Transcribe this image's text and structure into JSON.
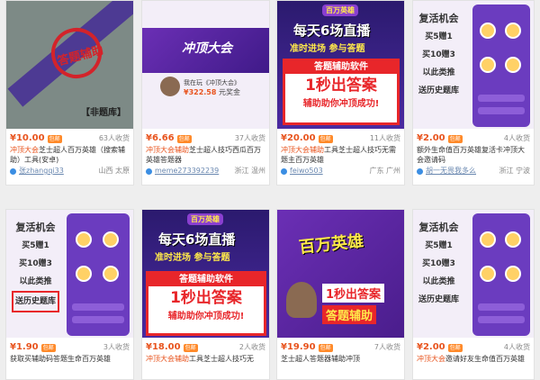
{
  "products": [
    {
      "price": "¥10.00",
      "tag": "包邮",
      "sold": "63人收货",
      "title_hl": "冲顶大会",
      "title": "芝士超人百万英雄（搜索辅助）工具(安卓)",
      "seller": "张zhangqi33",
      "location": "山西 太原",
      "thumb": {
        "stamp": "答题辅助",
        "label": "【非题库】"
      }
    },
    {
      "price": "¥6.66",
      "tag": "包邮",
      "sold": "37人收货",
      "title_hl": "冲顶大会辅助",
      "title": "芝士超人技巧西瓜百万英雄答题器",
      "seller": "meme273392239",
      "location": "浙江 温州",
      "thumb": {
        "logo": "冲顶大会",
        "line1": "我在玩《冲顶大会》",
        "amount": "¥322.58",
        "unit": "元奖金"
      }
    },
    {
      "price": "¥20.00",
      "tag": "包邮",
      "sold": "11人收货",
      "title_hl": "冲顶大会辅助",
      "title": "工具芝士超人技巧无需题主百万英雄",
      "seller": "feiwo503",
      "location": "广东 广州",
      "thumb": {
        "badge": "百万英雄",
        "head1": "每天6场直播",
        "head2": "准时进场 参与答题",
        "box1": "答题辅助软件",
        "box2": "1秒出答案",
        "box3": "辅助助你冲顶成功!"
      }
    },
    {
      "price": "¥2.00",
      "tag": "包邮",
      "sold": "4人收货",
      "title_hl": "冲顶",
      "title": "额外生命值百万英雄复活卡冲顶大会邀请码",
      "seller": "胡一无畏我多么",
      "location": "浙江 宁波",
      "thumb": {
        "r1": "复活机会",
        "r2": "买5赠1",
        "r3": "买10赠3",
        "r4": "以此类推",
        "r5": "送历史题库"
      }
    },
    {
      "price": "¥1.90",
      "tag": "包邮",
      "sold": "3人收货",
      "title_hl": "辅助",
      "title": "获取买辅助码答题生命百万英雄",
      "seller": "",
      "location": "",
      "thumb": {
        "r1": "复活机会",
        "r2": "买5赠1",
        "r3": "买10赠3",
        "r4": "以此类推",
        "r5": "送历史题库"
      }
    },
    {
      "price": "¥18.00",
      "tag": "包邮",
      "sold": "2人收货",
      "title_hl": "冲顶大会辅助",
      "title": "工具芝士超人技巧无",
      "seller": "",
      "location": "",
      "thumb": {
        "badge": "百万英雄",
        "head1": "每天6场直播",
        "head2": "准时进场 参与答题",
        "box1": "答题辅助软件",
        "box2": "1秒出答案",
        "box3": "辅助助你冲顶成功!"
      }
    },
    {
      "price": "¥19.90",
      "tag": "包邮",
      "sold": "7人收货",
      "title_hl": "",
      "title": "芝士超人答题器辅助冲顶",
      "seller": "",
      "location": "",
      "thumb": {
        "logo": "百万英雄",
        "b1": "1秒出答案",
        "b2": "答题辅助"
      }
    },
    {
      "price": "¥2.00",
      "tag": "包邮",
      "sold": "4人收货",
      "title_hl": "冲顶大会",
      "title": "邀请好友生命值百万英雄",
      "seller": "",
      "location": "",
      "thumb": {
        "r1": "复活机会",
        "r2": "买5赠1",
        "r3": "买10赠3",
        "r4": "以此类推",
        "r5": "送历史题库"
      }
    }
  ]
}
